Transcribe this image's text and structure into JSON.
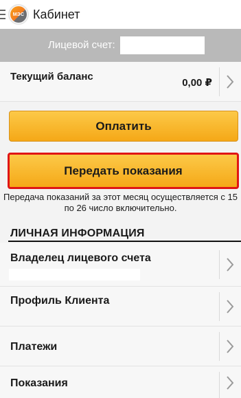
{
  "appbar": {
    "title": "Кабинет",
    "logo_text": "МЭС"
  },
  "account": {
    "label": "Лицевой счет:",
    "number": ""
  },
  "balance": {
    "label": "Текущий баланс",
    "value": "0,00 ₽"
  },
  "buttons": {
    "pay": "Оплатить",
    "submit_readings": "Передать показания"
  },
  "note": "Передача показаний за этот месяц осуществляется с 15 по 26 число включительно.",
  "section": {
    "title": "ЛИЧНАЯ ИНФОРМАЦИЯ"
  },
  "menu_items": [
    {
      "label": "Владелец лицевого счета",
      "subtitle": ""
    },
    {
      "label": "Профиль Клиента"
    },
    {
      "label": "Платежи"
    },
    {
      "label": "Показания"
    }
  ],
  "colors": {
    "button_fill": "#f5a817",
    "highlight_border": "#e01515",
    "account_bar": "#b9b9b9"
  }
}
